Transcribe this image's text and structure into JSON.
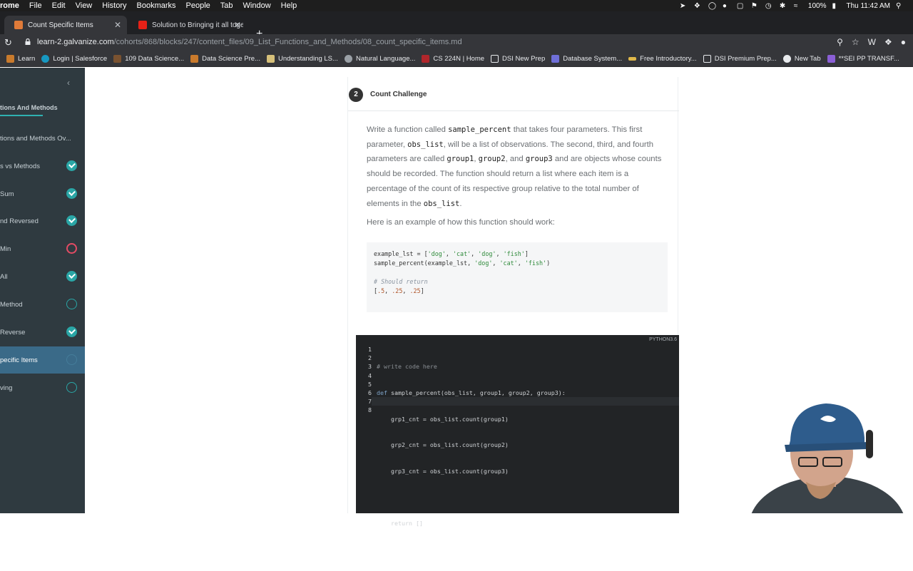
{
  "menubar": {
    "app": "rome",
    "items": [
      "File",
      "Edit",
      "View",
      "History",
      "Bookmarks",
      "People",
      "Tab",
      "Window",
      "Help"
    ],
    "battery": "100%",
    "clock": "Thu 11:42 AM"
  },
  "tabs": [
    {
      "title": "Count Specific Items",
      "active": true
    },
    {
      "title": "Solution to Bringing it all togeth",
      "active": false
    }
  ],
  "address": {
    "host": "learn-2.galvanize.com",
    "path": "/cohorts/868/blocks/247/content_files/09_List_Functions_and_Methods/08_count_specific_items.md"
  },
  "bookmarks": [
    "Learn",
    "Login | Salesforce",
    "109 Data Science...",
    "Data Science Pre...",
    "Understanding LS...",
    "Natural Language...",
    "CS 224N | Home",
    "DSI New Prep",
    "Database System...",
    "Free Introductory...",
    "DSI Premium Prep...",
    "New Tab",
    "**SEI PP TRANSF..."
  ],
  "sidebar": {
    "heading": "tions And Methods",
    "items": [
      {
        "label": "tions and Methods Ov...",
        "status": "none"
      },
      {
        "label": "s vs Methods",
        "status": "done"
      },
      {
        "label": "Sum",
        "status": "done"
      },
      {
        "label": "nd Reversed",
        "status": "done"
      },
      {
        "label": "Min",
        "status": "fail"
      },
      {
        "label": "All",
        "status": "done"
      },
      {
        "label": "Method",
        "status": "open"
      },
      {
        "label": "Reverse",
        "status": "done"
      },
      {
        "label": "pecific Items",
        "status": "active"
      },
      {
        "label": "ving",
        "status": "open"
      }
    ]
  },
  "lesson": {
    "number": "2",
    "title": "Count Challenge",
    "desc": {
      "p1": "Write a function called ",
      "c1": "sample_percent",
      "p2": " that takes four parameters. This first parameter, ",
      "c2": "obs_list",
      "p3": ", will be a list of observations. The second, third, and fourth parameters are called ",
      "c3": "group1",
      "p4": ", ",
      "c4": "group2",
      "p5": ", and ",
      "c5": "group3",
      "p6": " and are objects whose counts should be recorded. The function should return a list where each item is a percentage of the count of its respective group relative to the total number of elements in the ",
      "c6": "obs_list",
      "p7": "."
    },
    "example_intro": "Here is an example of how this function should work:",
    "example": {
      "l1a": "example_lst = [",
      "l1s1": "'dog'",
      "l1s2": "'cat'",
      "l1s3": "'dog'",
      "l1s4": "'fish'",
      "l2a": "sample_percent(example_lst, ",
      "l2s1": "'dog'",
      "l2s2": "'cat'",
      "l2s3": "'fish'",
      "l3": "# Should return",
      "l4a": "[",
      "l4n1": ".5",
      "l4n2": ".25",
      "l4n3": ".25",
      "l4b": "]"
    }
  },
  "editor": {
    "language": "PYTHON3.6",
    "line_numbers": [
      "1",
      "2",
      "3",
      "4",
      "5",
      "6",
      "7",
      "8"
    ],
    "lines": [
      "# write code here",
      "def sample_percent(obs_list, group1, group2, group3):",
      "    grp1_cnt = obs_list.count(group1)",
      "    grp2_cnt = obs_list.count(group2)",
      "    grp3_cnt = obs_list.count(group3)",
      "",
      "    return []",
      ""
    ]
  }
}
